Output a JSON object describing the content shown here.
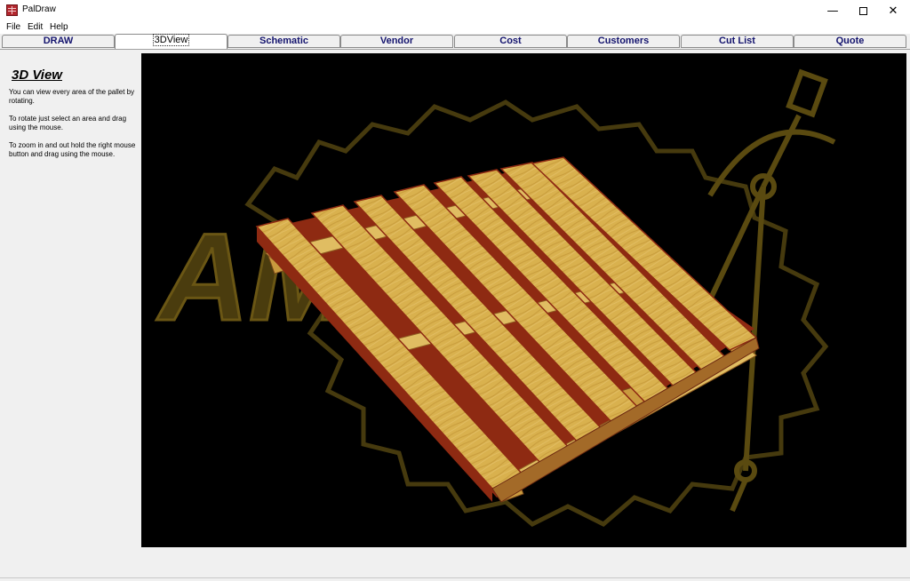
{
  "window": {
    "title": "PalDraw",
    "minimize_glyph": "—",
    "close_glyph": "✕"
  },
  "menu": [
    "File",
    "Edit",
    "Help"
  ],
  "tabs": [
    {
      "label": "DRAW",
      "active": false
    },
    {
      "label": "3DView",
      "active": true
    },
    {
      "label": "Schematic",
      "active": false
    },
    {
      "label": "Vendor",
      "active": false
    },
    {
      "label": "Cost",
      "active": false
    },
    {
      "label": "Customers",
      "active": false
    },
    {
      "label": "Cut List",
      "active": false
    },
    {
      "label": "Quote",
      "active": false
    }
  ],
  "sidebar": {
    "title": "3D View",
    "paragraphs": [
      "You can view every area of the pallet by rotating.",
      "To rotate just select an area and drag using the mouse.",
      "To zoom in and out hold the right mouse button and drag using the mouse."
    ]
  },
  "viewport": {
    "background_logo_text": "AMS",
    "colors": {
      "background": "#000000",
      "logo": "#5a4a10",
      "wood": "#d9b14e",
      "wood_dark": "#b08a32",
      "wood_edge": "#8e2a12"
    }
  }
}
